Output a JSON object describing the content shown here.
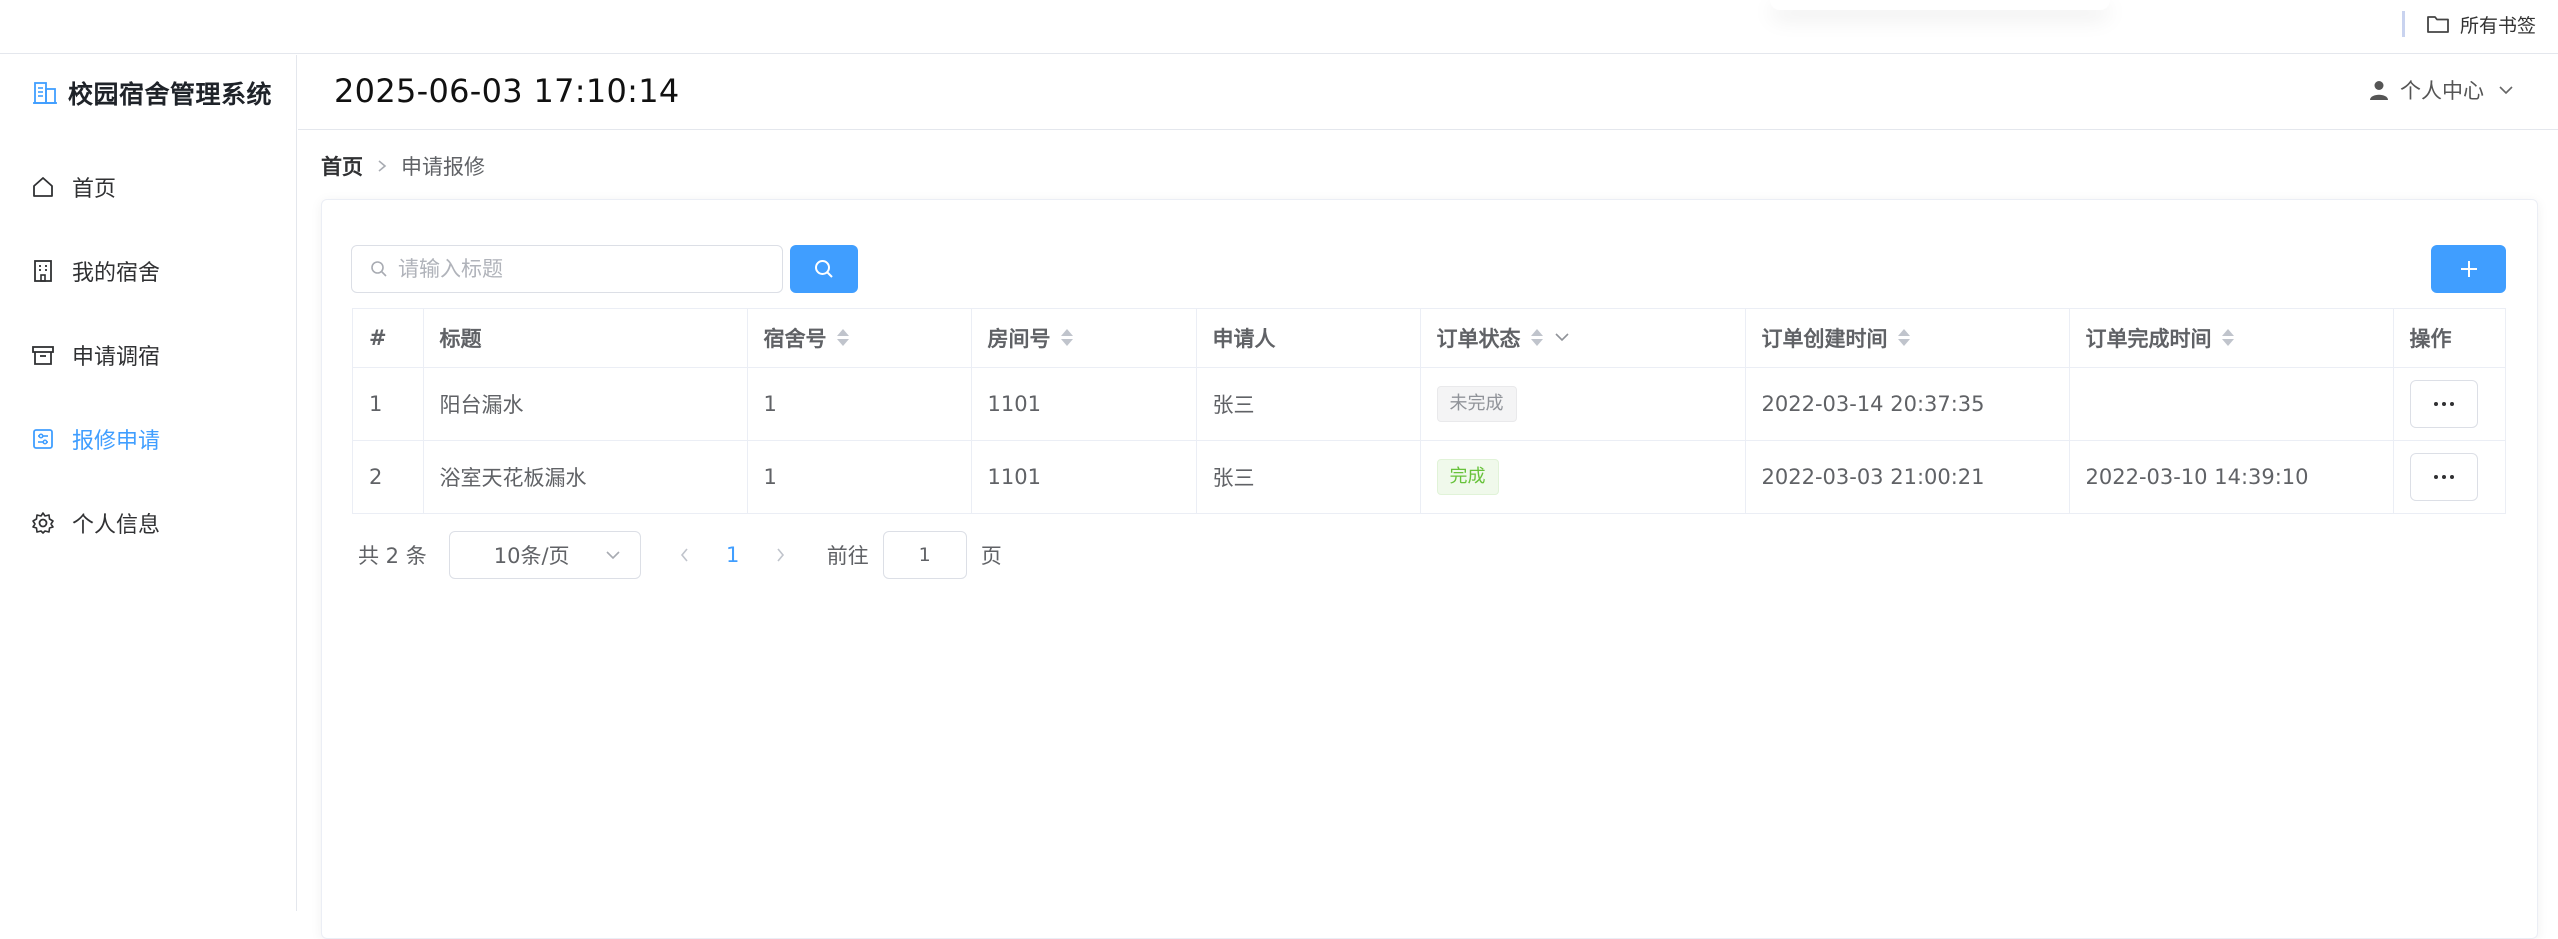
{
  "browser": {
    "bookmarks_label": "所有书签"
  },
  "app": {
    "title": "校园宿舍管理系统",
    "datetime": "2025-06-03 17:10:14",
    "user_menu_label": "个人中心",
    "accent_color": "#409eff"
  },
  "sidebar": {
    "items": [
      {
        "label": "首页",
        "icon": "home-icon",
        "active": false
      },
      {
        "label": "我的宿舍",
        "icon": "building-icon",
        "active": false
      },
      {
        "label": "申请调宿",
        "icon": "box-icon",
        "active": false
      },
      {
        "label": "报修申请",
        "icon": "repair-icon",
        "active": true
      },
      {
        "label": "个人信息",
        "icon": "gear-icon",
        "active": false
      }
    ]
  },
  "breadcrumb": {
    "home": "首页",
    "current": "申请报修"
  },
  "search": {
    "placeholder": "请输入标题",
    "value": ""
  },
  "table": {
    "columns": [
      "#",
      "标题",
      "宿舍号",
      "房间号",
      "申请人",
      "订单状态",
      "订单创建时间",
      "订单完成时间",
      "操作"
    ],
    "rows": [
      {
        "index": "1",
        "title": "阳台漏水",
        "dorm": "1",
        "room": "1101",
        "applicant": "张三",
        "status": "未完成",
        "status_type": "info",
        "created": "2022-03-14 20:37:35",
        "finished": ""
      },
      {
        "index": "2",
        "title": "浴室天花板漏水",
        "dorm": "1",
        "room": "1101",
        "applicant": "张三",
        "status": "完成",
        "status_type": "success",
        "created": "2022-03-03 21:00:21",
        "finished": "2022-03-10 14:39:10"
      }
    ]
  },
  "pagination": {
    "total_text": "共 2 条",
    "page_size": "10条/页",
    "current_page": "1",
    "goto_label": "前往",
    "goto_value": "1",
    "page_suffix": "页"
  }
}
